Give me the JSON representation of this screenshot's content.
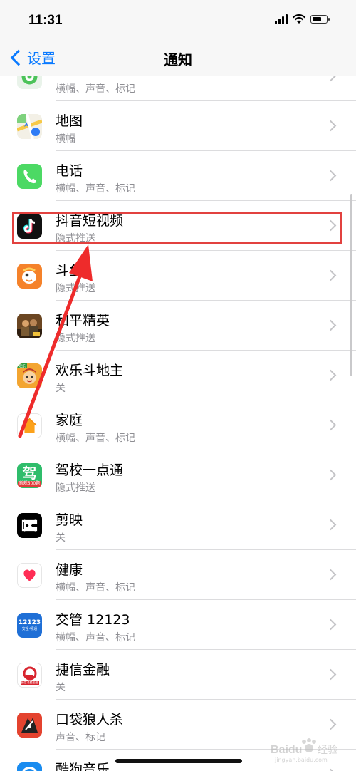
{
  "status": {
    "time": "11:31",
    "battery_level": 0.7
  },
  "nav": {
    "back_label": "设置",
    "title": "通知"
  },
  "rows": [
    {
      "title": "",
      "sub": "横幅、声音、标记",
      "icon": "find-my-icon"
    },
    {
      "title": "地图",
      "sub": "横幅",
      "icon": "maps-icon"
    },
    {
      "title": "电话",
      "sub": "横幅、声音、标记",
      "icon": "phone-icon"
    },
    {
      "title": "抖音短视频",
      "sub": "隐式推送",
      "icon": "tiktok-icon"
    },
    {
      "title": "斗鱼",
      "sub": "隐式推送",
      "icon": "douyu-icon"
    },
    {
      "title": "和平精英",
      "sub": "隐式推送",
      "icon": "game-icon"
    },
    {
      "title": "欢乐斗地主",
      "sub": "关",
      "icon": "card-game-icon",
      "badge": "欢乐"
    },
    {
      "title": "家庭",
      "sub": "横幅、声音、标记",
      "icon": "home-icon"
    },
    {
      "title": "驾校一点通",
      "sub": "隐式推送",
      "icon": "driving-school-icon",
      "glyph": "驾",
      "badge": "新规500题"
    },
    {
      "title": "剪映",
      "sub": "关",
      "icon": "capcut-icon"
    },
    {
      "title": "健康",
      "sub": "横幅、声音、标记",
      "icon": "health-icon"
    },
    {
      "title": "交管 12123",
      "sub": "横幅、声音、标记",
      "icon": "traffic-icon",
      "glyph": "12123",
      "caption": "安全·畅通"
    },
    {
      "title": "捷信金融",
      "sub": "关",
      "icon": "finance-icon",
      "caption": "捷信消费金融"
    },
    {
      "title": "口袋狼人杀",
      "sub": "声音、标记",
      "icon": "werewolf-icon"
    },
    {
      "title": "酷狗音乐",
      "sub": "",
      "icon": "kugou-icon"
    }
  ],
  "watermark": {
    "brand": "Baidu",
    "brand_cn": "经验",
    "url": "jingyan.baidu.com"
  },
  "colors": {
    "accent": "#0a7aff",
    "highlight": "#e2413f",
    "annotation_arrow": "#ee2b2b"
  }
}
